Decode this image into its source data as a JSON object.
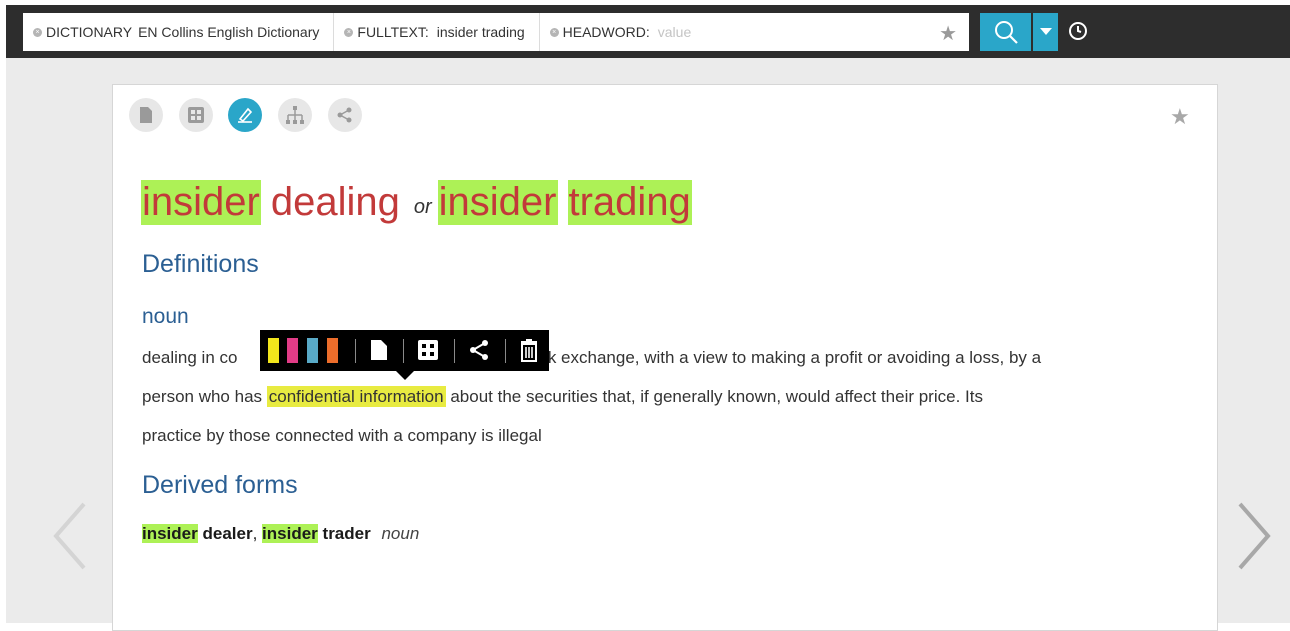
{
  "search": {
    "dictionary_label": "DICTIONARY",
    "dictionary_value": "EN Collins English Dictionary",
    "fulltext_label": "FULLTEXT:",
    "fulltext_value": "insider trading",
    "headword_label": "HEADWORD:",
    "headword_placeholder": "value"
  },
  "entry": {
    "title_part1": "insider",
    "title_part2": "dealing",
    "title_or": "or",
    "title_part3": "insider",
    "title_part4": "trading",
    "section_definitions": "Definitions",
    "pos": "noun",
    "def_line1_start": "dealing in co",
    "def_line1_end": "d stock exchange, with a view to making a profit or avoiding a loss, by a",
    "def_line2_start": "person who has",
    "def_line2_highlight": "confidential information",
    "def_line2_end": "about the securities that, if generally known, would affect their price. Its",
    "def_line3": "practice by those connected with a company is illegal",
    "section_derived": "Derived forms",
    "derived_w1": "insider",
    "derived_w2": "dealer",
    "derived_sep": ",",
    "derived_w3": "insider",
    "derived_w4": "trader",
    "derived_pos": "noun"
  },
  "colors": {
    "accent": "#2aa6c9",
    "headword_red": "#c23a3a",
    "heading_blue": "#2b5f93",
    "highlight_green": "#adf156",
    "highlight_yellow": "#e8eb41",
    "swatch_yellow": "#f2e61c",
    "swatch_pink": "#e23c87",
    "swatch_blue": "#59aac7",
    "swatch_orange": "#ec6d2b"
  },
  "icons": {
    "toolbar": [
      "document-icon",
      "table-icon",
      "highlighter-icon",
      "hierarchy-icon",
      "share-icon"
    ],
    "floating": [
      "note-icon",
      "grid-icon",
      "share-icon",
      "trash-icon"
    ]
  }
}
